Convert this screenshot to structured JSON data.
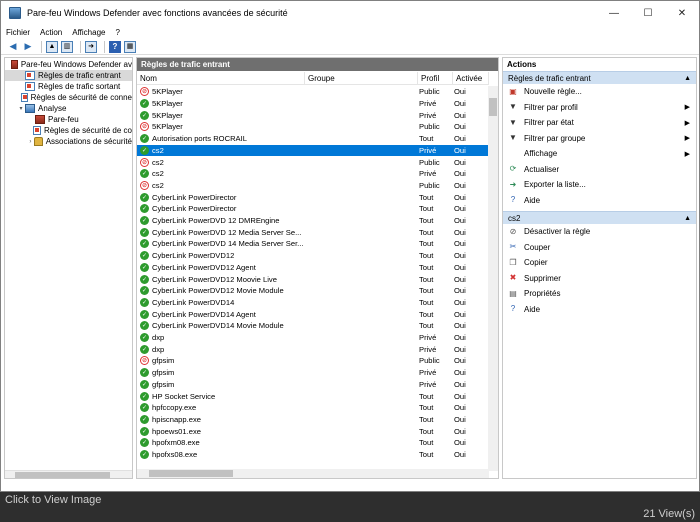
{
  "window": {
    "title": "Pare-feu Windows Defender avec fonctions avancées de sécurité"
  },
  "menu": [
    "Fichier",
    "Action",
    "Affichage",
    "?"
  ],
  "tree": [
    {
      "label": "Pare-feu Windows Defender av",
      "level": 0,
      "icon": "firewall-icon",
      "twisty": ""
    },
    {
      "label": "Règles de trafic entrant",
      "level": 1,
      "icon": "rule-icon",
      "twisty": "",
      "selected": true
    },
    {
      "label": "Règles de trafic sortant",
      "level": 1,
      "icon": "rule-icon",
      "twisty": ""
    },
    {
      "label": "Règles de sécurité de conne",
      "level": 1,
      "icon": "rule-icon",
      "twisty": ""
    },
    {
      "label": "Analyse",
      "level": 1,
      "icon": "monitor-icon",
      "twisty": "▾"
    },
    {
      "label": "Pare-feu",
      "level": 2,
      "icon": "firewall-icon",
      "twisty": ""
    },
    {
      "label": "Règles de sécurité de co",
      "level": 2,
      "icon": "rule-icon",
      "twisty": ""
    },
    {
      "label": "Associations de sécurité",
      "level": 2,
      "icon": "lock-icon",
      "twisty": "›"
    }
  ],
  "center": {
    "title": "Règles de trafic entrant",
    "columns": {
      "name": "Nom",
      "group": "Groupe",
      "profile": "Profil",
      "enabled": "Activée"
    },
    "rows": [
      {
        "name": "5KPlayer",
        "profile": "Public",
        "enabled": "Oui",
        "status": "block"
      },
      {
        "name": "5KPlayer",
        "profile": "Privé",
        "enabled": "Oui",
        "status": "allow"
      },
      {
        "name": "5KPlayer",
        "profile": "Privé",
        "enabled": "Oui",
        "status": "allow"
      },
      {
        "name": "5KPlayer",
        "profile": "Public",
        "enabled": "Oui",
        "status": "block"
      },
      {
        "name": "Autorisation ports ROCRAIL",
        "profile": "Tout",
        "enabled": "Oui",
        "status": "allow"
      },
      {
        "name": "cs2",
        "profile": "Privé",
        "enabled": "Oui",
        "status": "allow",
        "selected": true
      },
      {
        "name": "cs2",
        "profile": "Public",
        "enabled": "Oui",
        "status": "block"
      },
      {
        "name": "cs2",
        "profile": "Privé",
        "enabled": "Oui",
        "status": "allow"
      },
      {
        "name": "cs2",
        "profile": "Public",
        "enabled": "Oui",
        "status": "block"
      },
      {
        "name": "CyberLink PowerDirector",
        "profile": "Tout",
        "enabled": "Oui",
        "status": "allow"
      },
      {
        "name": "CyberLink PowerDirector",
        "profile": "Tout",
        "enabled": "Oui",
        "status": "allow"
      },
      {
        "name": "CyberLink PowerDVD 12 DMREngine",
        "profile": "Tout",
        "enabled": "Oui",
        "status": "allow"
      },
      {
        "name": "CyberLink PowerDVD 12 Media Server Se...",
        "profile": "Tout",
        "enabled": "Oui",
        "status": "allow"
      },
      {
        "name": "CyberLink PowerDVD 14 Media Server Ser...",
        "profile": "Tout",
        "enabled": "Oui",
        "status": "allow"
      },
      {
        "name": "CyberLink PowerDVD12",
        "profile": "Tout",
        "enabled": "Oui",
        "status": "allow"
      },
      {
        "name": "CyberLink PowerDVD12 Agent",
        "profile": "Tout",
        "enabled": "Oui",
        "status": "allow"
      },
      {
        "name": "CyberLink PowerDVD12 Moovie Live",
        "profile": "Tout",
        "enabled": "Oui",
        "status": "allow"
      },
      {
        "name": "CyberLink PowerDVD12 Movie Module",
        "profile": "Tout",
        "enabled": "Oui",
        "status": "allow"
      },
      {
        "name": "CyberLink PowerDVD14",
        "profile": "Tout",
        "enabled": "Oui",
        "status": "allow"
      },
      {
        "name": "CyberLink PowerDVD14 Agent",
        "profile": "Tout",
        "enabled": "Oui",
        "status": "allow"
      },
      {
        "name": "CyberLink PowerDVD14 Movie Module",
        "profile": "Tout",
        "enabled": "Oui",
        "status": "allow"
      },
      {
        "name": "dxp",
        "profile": "Privé",
        "enabled": "Oui",
        "status": "allow"
      },
      {
        "name": "dxp",
        "profile": "Privé",
        "enabled": "Oui",
        "status": "allow"
      },
      {
        "name": "gfpsim",
        "profile": "Public",
        "enabled": "Oui",
        "status": "block"
      },
      {
        "name": "gfpsim",
        "profile": "Privé",
        "enabled": "Oui",
        "status": "allow"
      },
      {
        "name": "gfpsim",
        "profile": "Privé",
        "enabled": "Oui",
        "status": "allow"
      },
      {
        "name": "HP Socket Service",
        "profile": "Tout",
        "enabled": "Oui",
        "status": "allow"
      },
      {
        "name": "hpfccopy.exe",
        "profile": "Tout",
        "enabled": "Oui",
        "status": "allow"
      },
      {
        "name": "hpiscnapp.exe",
        "profile": "Tout",
        "enabled": "Oui",
        "status": "allow"
      },
      {
        "name": "hpoews01.exe",
        "profile": "Tout",
        "enabled": "Oui",
        "status": "allow"
      },
      {
        "name": "hpofxm08.exe",
        "profile": "Tout",
        "enabled": "Oui",
        "status": "allow"
      },
      {
        "name": "hpofxs08.exe",
        "profile": "Tout",
        "enabled": "Oui",
        "status": "allow"
      }
    ]
  },
  "actions": {
    "title": "Actions",
    "sections": [
      {
        "title": "Règles de trafic entrant",
        "items": [
          {
            "label": "Nouvelle règle...",
            "icon": "new-rule-icon",
            "glyph": "▣",
            "color": "#c0392b",
            "submenu": false
          },
          {
            "label": "Filtrer par profil",
            "icon": "filter-icon",
            "glyph": "▼",
            "color": "#333333",
            "submenu": true
          },
          {
            "label": "Filtrer par état",
            "icon": "filter-icon",
            "glyph": "▼",
            "color": "#333333",
            "submenu": true
          },
          {
            "label": "Filtrer par groupe",
            "icon": "filter-icon",
            "glyph": "▼",
            "color": "#333333",
            "submenu": true
          },
          {
            "label": "Affichage",
            "icon": "view-icon",
            "glyph": "",
            "color": "#333333",
            "submenu": true
          },
          {
            "label": "Actualiser",
            "icon": "refresh-icon",
            "glyph": "⟳",
            "color": "#2e8b57",
            "submenu": false
          },
          {
            "label": "Exporter la liste...",
            "icon": "export-icon",
            "glyph": "➜",
            "color": "#2e8b57",
            "submenu": false
          },
          {
            "label": "Aide",
            "icon": "help-icon",
            "glyph": "?",
            "color": "#2b5fb0",
            "submenu": false
          }
        ]
      },
      {
        "title": "cs2",
        "items": [
          {
            "label": "Désactiver la règle",
            "icon": "disable-rule-icon",
            "glyph": "⊘",
            "color": "#555555",
            "submenu": false
          },
          {
            "label": "Couper",
            "icon": "cut-icon",
            "glyph": "✂",
            "color": "#2b5fb0",
            "submenu": false
          },
          {
            "label": "Copier",
            "icon": "copy-icon",
            "glyph": "❐",
            "color": "#555555",
            "submenu": false
          },
          {
            "label": "Supprimer",
            "icon": "delete-icon",
            "glyph": "✖",
            "color": "#d33333",
            "submenu": false
          },
          {
            "label": "Propriétés",
            "icon": "properties-icon",
            "glyph": "▤",
            "color": "#555555",
            "submenu": false
          },
          {
            "label": "Aide",
            "icon": "help-icon",
            "glyph": "?",
            "color": "#2b5fb0",
            "submenu": false
          }
        ]
      }
    ]
  },
  "footer": {
    "left": "Click to View Image",
    "right": "21 View(s)"
  }
}
